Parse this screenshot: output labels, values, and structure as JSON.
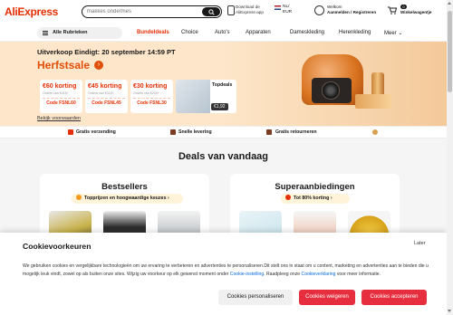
{
  "header": {
    "logo": "AliExpress",
    "search_placeholder": "makkes ondermes",
    "download_line1": "Download de",
    "download_line2": "AliExpress-app",
    "lang_line1": "NL/",
    "lang_line2": "EUR",
    "user_line1": "Welkom",
    "user_line2": "Aanmelden / Registreren",
    "cart_count": "0",
    "cart_label": "Winkelwagentje"
  },
  "nav": {
    "categories": "Alle Rubrieken",
    "items": [
      "Bundeldeals",
      "Choice",
      "Auto's",
      "Apparaten",
      "Dameskleding",
      "Herenkleding",
      "Meer"
    ],
    "active_color": "#e62e04"
  },
  "promo": {
    "title": "Uitverkoop Eindigt: 20 september 14:59 PT",
    "sale": "Herfstsale",
    "coupons": [
      {
        "amount": "€60 korting",
        "min": "Orders van €415+",
        "code": "Code FSNL60"
      },
      {
        "amount": "€45 korting",
        "min": "Orders van €315+",
        "code": "Code FSNL45"
      },
      {
        "amount": "€30 korting",
        "min": "Orders van €209+",
        "code": "Code FSNL30"
      }
    ],
    "topdeals_label": "Topdeals",
    "topdeals_price": "€1,92",
    "terms": "Bekijk voorwaarden"
  },
  "features": [
    "Gratis verzending",
    "Snelle levering",
    "Gratis retourneren"
  ],
  "deals": {
    "title": "Deals van vandaag",
    "bestsellers": {
      "title": "Bestsellers",
      "pill": "Topprijzen en hoogwaardige keuzes"
    },
    "super": {
      "title": "Superaanbiedingen",
      "pill": "Tot 80% korting"
    }
  },
  "cookie": {
    "title": "Cookievoorkeuren",
    "later": "Later",
    "text1": "We gebruiken cookies en vergelijkbare technologieën om uw ervaring te verbeteren en advertenties te personaliseren.Dit stelt ons in staat om u content, marketing en",
    "text2": "advertenties aan te bieden die u mogelijk leuk vindt, zowel op als buiten onze sites. Wijzig uw voorkeur op elk gewenst moment onder",
    "link1": "Cookie-instelling",
    "text3": ". Raadpleeg onze",
    "link2": "Cookieverklaring",
    "text4": "voor meer informatie.",
    "btn_personalize": "Cookies personaliseren",
    "btn_reject": "Cookies weigeren",
    "btn_accept": "Cookies accepteren",
    "accent": "#e62e3f"
  }
}
